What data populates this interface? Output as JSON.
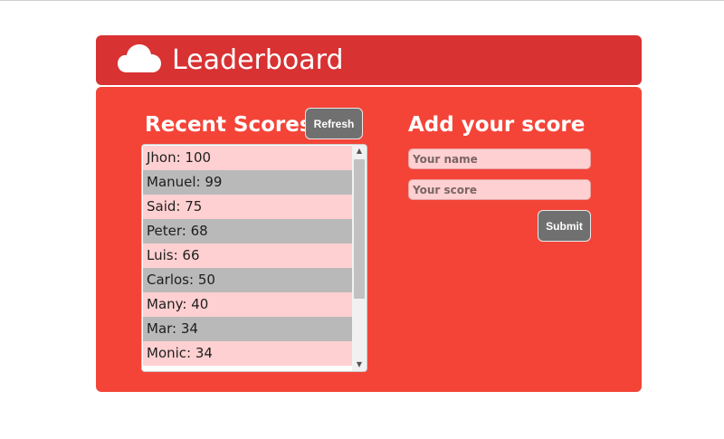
{
  "header": {
    "title": "Leaderboard",
    "icon": "cloud-icon"
  },
  "recent": {
    "title": "Recent Scores",
    "refresh_label": "Refresh",
    "scores": [
      {
        "name": "Jhon",
        "score": 100,
        "text": "Jhon: 100"
      },
      {
        "name": "Manuel",
        "score": 99,
        "text": "Manuel: 99"
      },
      {
        "name": "Said",
        "score": 75,
        "text": "Said: 75"
      },
      {
        "name": "Peter",
        "score": 68,
        "text": "Peter: 68"
      },
      {
        "name": "Luis",
        "score": 66,
        "text": "Luis: 66"
      },
      {
        "name": "Carlos",
        "score": 50,
        "text": "Carlos: 50"
      },
      {
        "name": "Many",
        "score": 40,
        "text": "Many: 40"
      },
      {
        "name": "Mar",
        "score": 34,
        "text": "Mar: 34"
      },
      {
        "name": "Monic",
        "score": 34,
        "text": "Monic: 34"
      }
    ]
  },
  "add": {
    "title": "Add your score",
    "name_placeholder": "Your name",
    "score_placeholder": "Your score",
    "submit_label": "Submit"
  },
  "colors": {
    "header_bg": "#d83233",
    "panel_bg": "#f44438",
    "row_odd": "#ffd0d1",
    "row_even": "#b9b9b9",
    "button_bg": "#707070"
  }
}
